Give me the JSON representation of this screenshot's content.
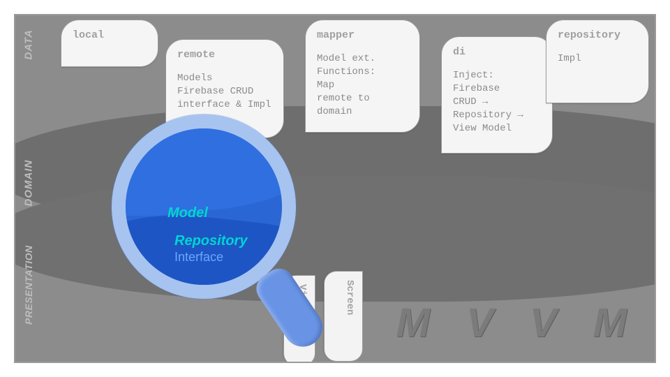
{
  "layers": {
    "data": "DATA",
    "domain": "DOMAIN",
    "presentation": "PRESENTATION"
  },
  "cards": {
    "local": {
      "title": "local",
      "body": ""
    },
    "remote": {
      "title": "remote",
      "body": "Models\nFirebase CRUD interface & Impl"
    },
    "mapper": {
      "title": "mapper",
      "body": "Model ext. Functions:\nMap\nremote to\ndomain"
    },
    "di": {
      "title": "di",
      "body": "Inject:\nFirebase\nCRUD →\nRepository →\nView Model"
    },
    "repo": {
      "title": "repository",
      "body": "Impl"
    }
  },
  "tabs": {
    "view": "View",
    "screen": "Screen"
  },
  "magnifier": {
    "model": "Model",
    "repository": "Repository",
    "interface": "Interface"
  },
  "watermark": "M V V M"
}
